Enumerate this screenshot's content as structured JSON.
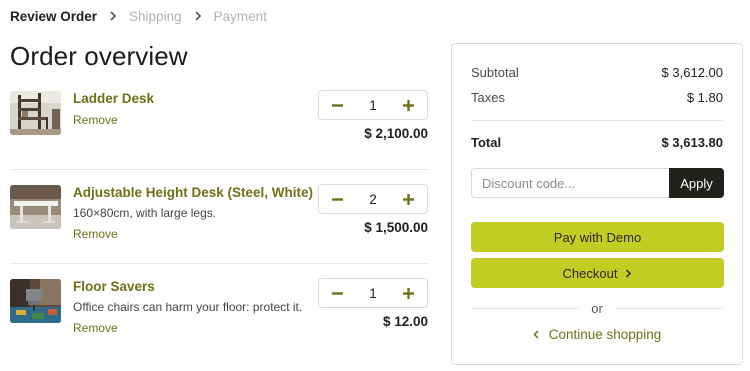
{
  "breadcrumb": {
    "steps": [
      {
        "label": "Review Order",
        "active": true
      },
      {
        "label": "Shipping",
        "active": false
      },
      {
        "label": "Payment",
        "active": false
      }
    ],
    "separator_icon": "chevron-right-icon"
  },
  "page_title": "Order overview",
  "items": [
    {
      "name": "Ladder Desk",
      "description": "",
      "remove_label": "Remove",
      "quantity": "1",
      "price": "$ 2,100.00",
      "thumbnail": "ladder-desk-image"
    },
    {
      "name": "Adjustable Height Desk (Steel, White)",
      "description": "160×80cm, with large legs.",
      "remove_label": "Remove",
      "quantity": "2",
      "price": "$ 1,500.00",
      "thumbnail": "adjustable-desk-image"
    },
    {
      "name": "Floor Savers",
      "description": "Office chairs can harm your floor: protect it.",
      "remove_label": "Remove",
      "quantity": "1",
      "price": "$ 12.00",
      "thumbnail": "floor-savers-image"
    }
  ],
  "summary": {
    "subtotal_label": "Subtotal",
    "subtotal_value": "$ 3,612.00",
    "taxes_label": "Taxes",
    "taxes_value": "$ 1.80",
    "total_label": "Total",
    "total_value": "$ 3,613.80",
    "discount_placeholder": "Discount code...",
    "apply_label": "Apply",
    "pay_label": "Pay with Demo",
    "checkout_label": "Checkout",
    "or_label": "or",
    "continue_label": "Continue shopping"
  },
  "colors": {
    "accent_olive": "#707018",
    "button_lime": "#c3cc22",
    "apply_dark": "#20211c"
  }
}
